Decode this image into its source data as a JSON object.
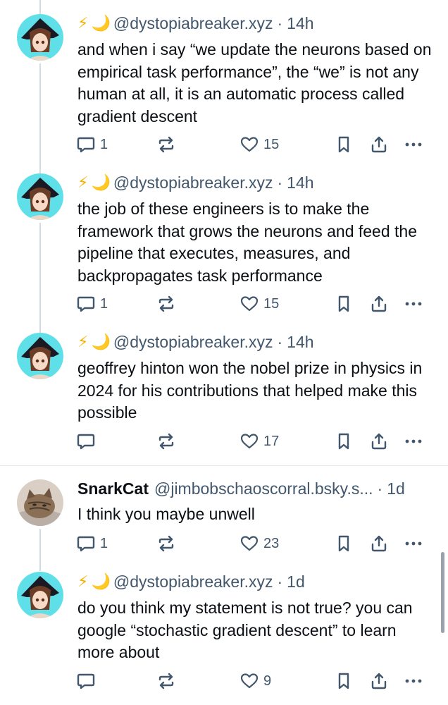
{
  "posts": [
    {
      "emoji": [
        "⚡",
        "🌙"
      ],
      "name": "",
      "handle": "@dystopiabreaker.xyz",
      "separator": "·",
      "time": "14h",
      "text": "and when i say “we update the neurons based on empirical task performance”, the “we” is not any human at all, it is an automatic process called gradient descent",
      "replies": "1",
      "likes": "15"
    },
    {
      "emoji": [
        "⚡",
        "🌙"
      ],
      "name": "",
      "handle": "@dystopiabreaker.xyz",
      "separator": "·",
      "time": "14h",
      "text": "the job of these engineers is to make the framework that grows the neurons and feed the pipeline that executes, measures, and backpropagates task performance",
      "replies": "1",
      "likes": "15"
    },
    {
      "emoji": [
        "⚡",
        "🌙"
      ],
      "name": "",
      "handle": "@dystopiabreaker.xyz",
      "separator": "·",
      "time": "14h",
      "text": "geoffrey hinton won the nobel prize in physics in 2024 for his contributions that helped make this possible",
      "replies": "",
      "likes": "17"
    },
    {
      "emoji": [],
      "name": "SnarkCat",
      "handle": "@jimbobschaoscorral.bsky.s...",
      "separator": "·",
      "time": "1d",
      "text": "I think you maybe unwell",
      "replies": "1",
      "likes": "23"
    },
    {
      "emoji": [
        "⚡",
        "🌙"
      ],
      "name": "",
      "handle": "@dystopiabreaker.xyz",
      "separator": "·",
      "time": "1d",
      "text": "do you think my statement is not true? you can google “stochastic gradient descent” to learn more about",
      "replies": "",
      "likes": "9"
    }
  ],
  "icons": {
    "reply": "reply-icon",
    "repost": "repost-icon",
    "like": "heart-icon",
    "bookmark": "bookmark-icon",
    "share": "share-icon",
    "more": "more-icon"
  },
  "colors": {
    "text": "#0b0f14",
    "muted": "#42576c",
    "thread_line": "#d4dbe2",
    "divider": "#e3e8ed",
    "bolt": "#f5b301"
  }
}
